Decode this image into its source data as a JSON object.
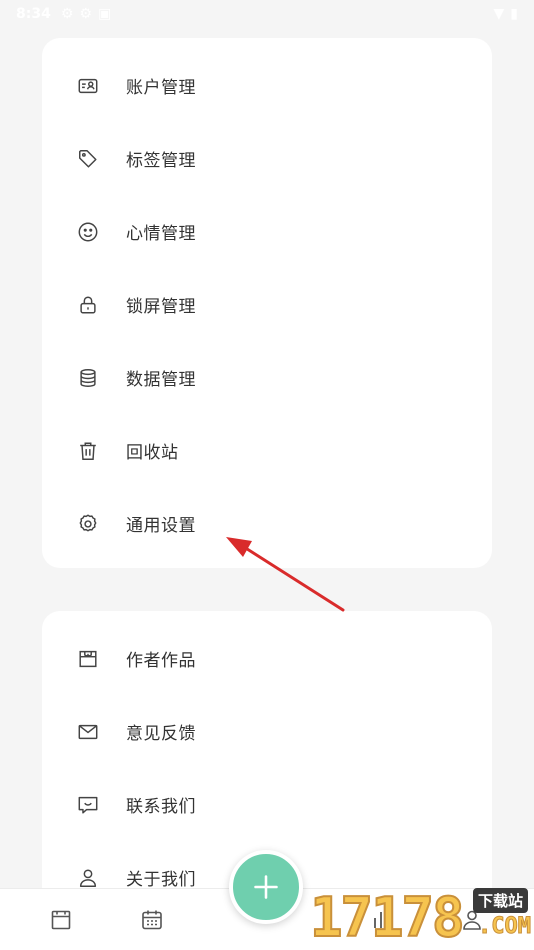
{
  "status_bar": {
    "time": "8:34"
  },
  "colors": {
    "accent": "#6fcfae",
    "card_bg": "#ffffff",
    "page_bg": "#f5f5f5",
    "arrow": "#d92b2b"
  },
  "card1": {
    "items": [
      {
        "label": "账户管理",
        "icon": "account-card-icon"
      },
      {
        "label": "标签管理",
        "icon": "tag-icon"
      },
      {
        "label": "心情管理",
        "icon": "smile-icon"
      },
      {
        "label": "锁屏管理",
        "icon": "lock-icon"
      },
      {
        "label": "数据管理",
        "icon": "database-icon"
      },
      {
        "label": "回收站",
        "icon": "trash-icon"
      },
      {
        "label": "通用设置",
        "icon": "gear-icon"
      }
    ]
  },
  "card2": {
    "items": [
      {
        "label": "作者作品",
        "icon": "store-icon"
      },
      {
        "label": "意见反馈",
        "icon": "mail-icon"
      },
      {
        "label": "联系我们",
        "icon": "chat-smile-icon"
      },
      {
        "label": "关于我们",
        "icon": "user-icon"
      }
    ]
  },
  "bottom_nav": {
    "items": [
      {
        "icon": "archive-icon"
      },
      {
        "icon": "calendar-icon"
      },
      {
        "icon": "chart-icon"
      },
      {
        "icon": "person-icon"
      }
    ],
    "fab_icon": "plus-icon"
  },
  "watermark": {
    "number": "17178",
    "top": "下载站",
    "suffix": ".COM"
  }
}
